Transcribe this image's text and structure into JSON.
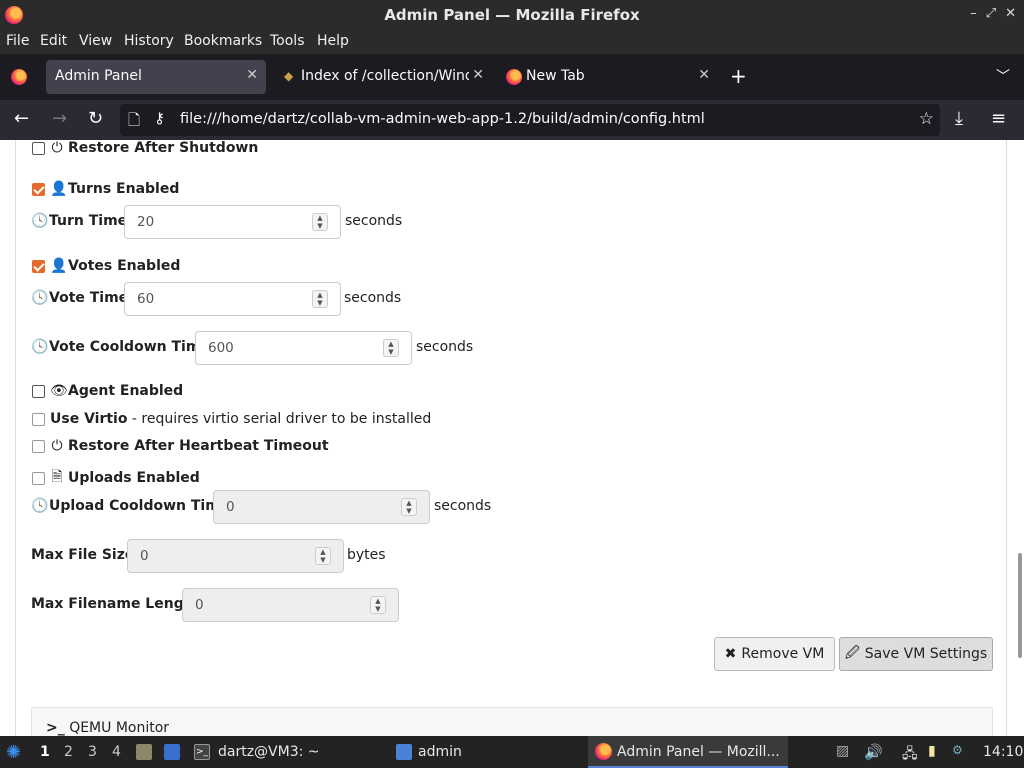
{
  "window": {
    "title": "Admin Panel — Mozilla Firefox"
  },
  "menu": [
    "File",
    "Edit",
    "View",
    "History",
    "Bookmarks",
    "Tools",
    "Help"
  ],
  "tabs": [
    {
      "label": "Admin Panel"
    },
    {
      "label": "Index of /collection/Windo"
    },
    {
      "label": "New Tab"
    }
  ],
  "nav": {
    "url": "file:///home/dartz/collab-vm-admin-web-app-1.2/build/admin/config.html"
  },
  "form": {
    "restore_after_shutdown": {
      "label": "Restore After Shutdown",
      "checked": false
    },
    "turns_enabled": {
      "label": "Turns Enabled",
      "checked": true
    },
    "turn_time": {
      "label": "Turn Time:",
      "value": "20",
      "unit": "seconds"
    },
    "votes_enabled": {
      "label": "Votes Enabled",
      "checked": true
    },
    "vote_time": {
      "label": "Vote Time:",
      "value": "60",
      "unit": "seconds"
    },
    "vote_cooldown": {
      "label": "Vote Cooldown Time:",
      "value": "600",
      "unit": "seconds"
    },
    "agent_enabled": {
      "label": "Agent Enabled",
      "checked": false
    },
    "use_virtio": {
      "label": "Use Virtio",
      "note": " - requires virtio serial driver to be installed",
      "checked": false
    },
    "restore_heartbeat": {
      "label": "Restore After Heartbeat Timeout",
      "checked": false
    },
    "uploads_enabled": {
      "label": "Uploads Enabled",
      "checked": false
    },
    "upload_cooldown": {
      "label": "Upload Cooldown Time:",
      "value": "0",
      "unit": "seconds"
    },
    "max_file_size": {
      "label": "Max File Size:",
      "value": "0",
      "unit": "bytes"
    },
    "max_filename_length": {
      "label": "Max Filename Length:",
      "value": "0"
    },
    "remove_vm": "Remove VM",
    "save_vm": "Save VM Settings",
    "qemu_monitor": "QEMU Monitor"
  },
  "taskbar": {
    "workspaces": [
      "1",
      "2",
      "3",
      "4"
    ],
    "terminal": "dartz@VM3: ~",
    "folder": "admin",
    "firefox": "Admin Panel — Mozill...",
    "clock": "14:10"
  },
  "colors": {
    "checkbox_checked": "#e66a2c",
    "chrome_dark": "#2b2a33"
  }
}
